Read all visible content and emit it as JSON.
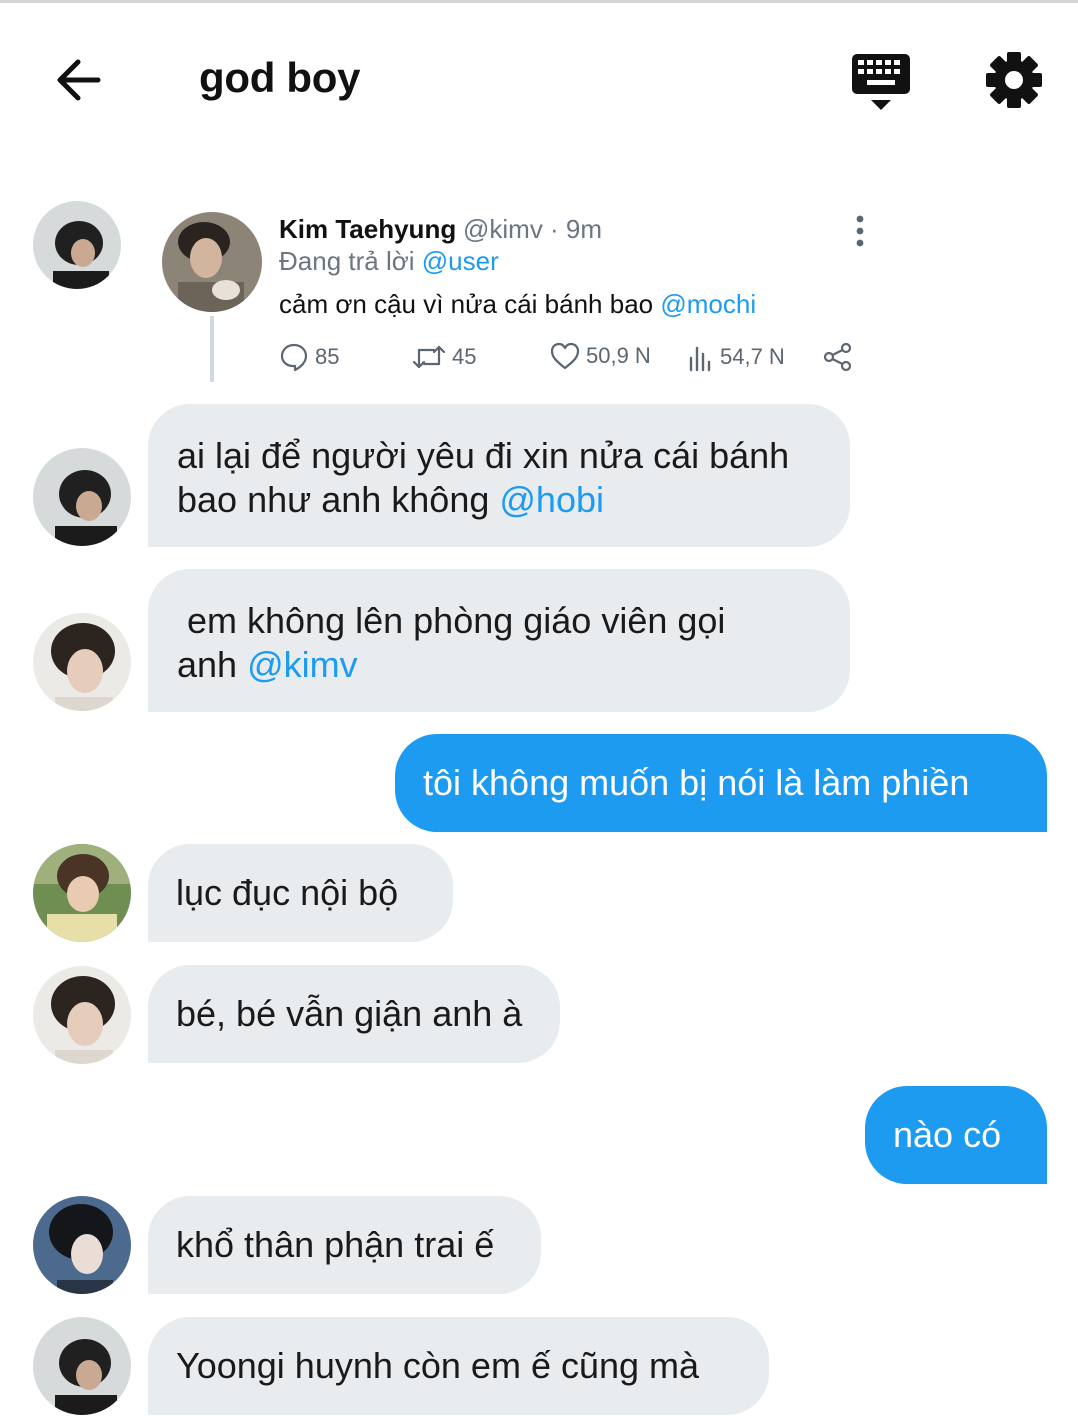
{
  "header": {
    "title": "god boy",
    "back_icon": "arrow-left-icon",
    "keyboard_icon": "keyboard-icon",
    "settings_icon": "gear-icon"
  },
  "quoted_tweet": {
    "name": "Kim Taehyung",
    "handle": "@kimv · 9m",
    "replying_prefix": "Đang trả lời ",
    "replying_to": "@user",
    "text": "cảm ơn cậu vì nửa cái bánh bao ",
    "mention": "@mochi",
    "stats": {
      "replies": "85",
      "retweets": "45",
      "likes": "50,9 N",
      "views": "54,7 N"
    }
  },
  "messages": [
    {
      "line1": "ai lại để người yêu đi xin nửa cái bánh",
      "line2": "bao như anh không ",
      "mention": "@hobi"
    },
    {
      "line1": " em không lên phòng giáo viên gọi",
      "line2": "anh ",
      "mention": "@kimv"
    },
    {
      "text": "tôi không muốn bị nói là làm phiền"
    },
    {
      "text": "lục đục nội bộ"
    },
    {
      "text": "bé, bé vẫn giận anh à"
    },
    {
      "text": "nào có"
    },
    {
      "text": "khổ thân phận trai ế"
    },
    {
      "text": "Yoongi huynh còn em ế cũng mà"
    }
  ],
  "colors": {
    "accent": "#1d9bf0",
    "bubble_received": "#e8ecef",
    "muted_text": "#6b7680"
  }
}
